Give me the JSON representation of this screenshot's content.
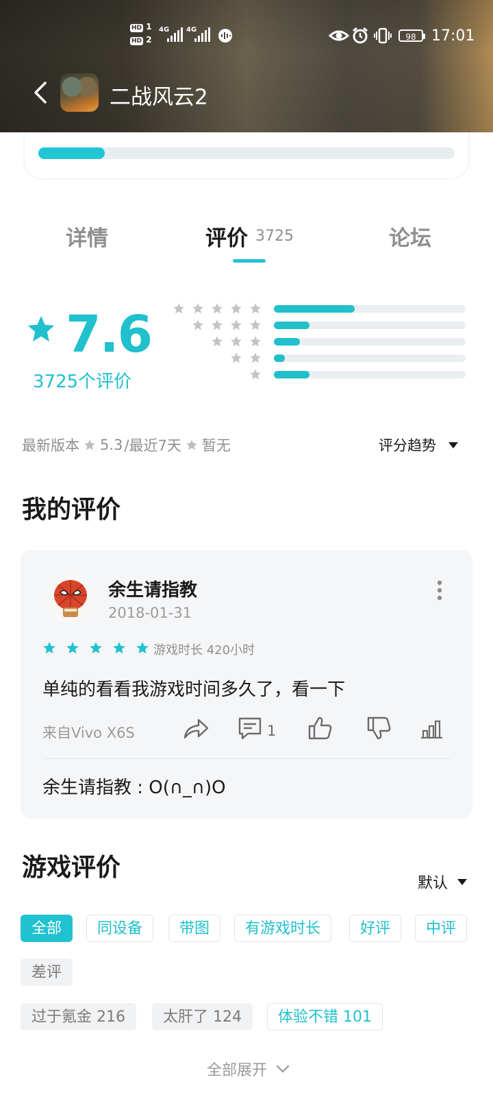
{
  "status_bar": {
    "hd1": "HD",
    "sim1": "1",
    "hd2": "HD",
    "sim2": "2",
    "net1": "4G",
    "net2": "4G",
    "battery": "98",
    "time": "17:01"
  },
  "header": {
    "title": "二战风云2",
    "icon": "game-app-icon"
  },
  "progress": {
    "fraction": 0.16
  },
  "tabs": [
    {
      "label": "详情",
      "active": false
    },
    {
      "label": "评价",
      "count": "3725",
      "active": true
    },
    {
      "label": "论坛",
      "active": false
    }
  ],
  "rating": {
    "score": "7.6",
    "count_text": "3725个评价",
    "distribution": [
      {
        "stars": 5,
        "fraction": 0.43
      },
      {
        "stars": 4,
        "fraction": 0.19
      },
      {
        "stars": 3,
        "fraction": 0.14
      },
      {
        "stars": 2,
        "fraction": 0.06
      },
      {
        "stars": 1,
        "fraction": 0.19
      }
    ],
    "latest_version_label": "最新版本",
    "latest_version_score": "5.3",
    "recent_label": "/最近7天",
    "recent_score": "暂无",
    "trend_label": "评分趋势"
  },
  "my_review": {
    "section_title": "我的评价",
    "user_name": "余生请指教",
    "date": "2018-01-31",
    "stars": 5,
    "play_time": "游戏时长 420小时",
    "text": "单纯的看看我游戏时间多久了，看一下",
    "device": "来自Vivo X6S",
    "reply_count": "1",
    "reply_text": "余生请指教 : O(∩_∩)O"
  },
  "game_reviews": {
    "section_title": "游戏评价",
    "sort_label": "默认",
    "filters": [
      "全部",
      "同设备",
      "带图",
      "有游戏时长",
      "好评",
      "中评",
      "差评"
    ],
    "tags": [
      "过于氪金 216",
      "太肝了 124",
      "体验不错 101"
    ],
    "expand_label": "全部展开"
  },
  "colors": {
    "accent": "#20c2cf",
    "muted_star": "#c4c4c4",
    "card_bg": "#f5f6f8"
  }
}
